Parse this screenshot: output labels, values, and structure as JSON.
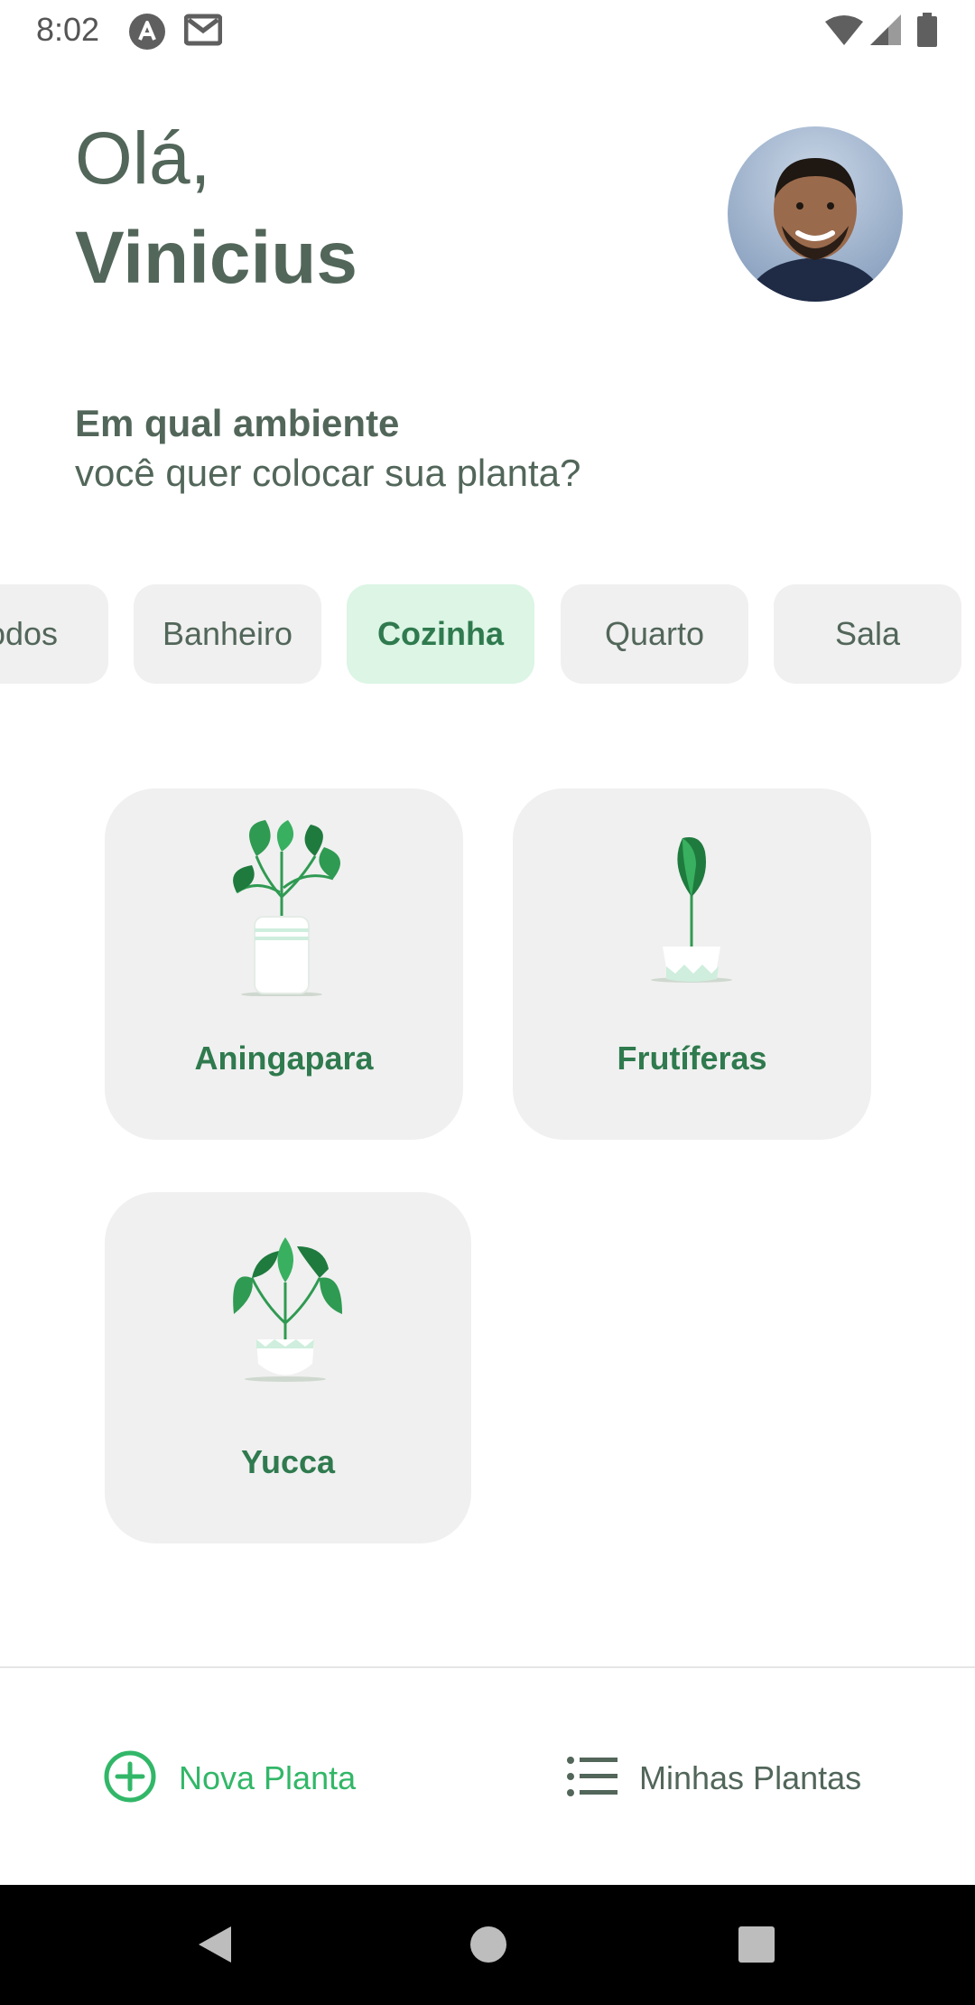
{
  "status_bar": {
    "time": "8:02",
    "icons_left": [
      "notification-a-icon",
      "gmail-icon"
    ],
    "icons_right": [
      "wifi-icon",
      "signal-icon",
      "battery-icon"
    ]
  },
  "header": {
    "greeting": "Olá,",
    "user_name": "Vinicius"
  },
  "question": {
    "title": "Em qual ambiente",
    "subtitle": "você quer colocar sua planta?"
  },
  "environments": [
    {
      "label": "Todos",
      "active": false
    },
    {
      "label": "Banheiro",
      "active": false
    },
    {
      "label": "Cozinha",
      "active": true
    },
    {
      "label": "Quarto",
      "active": false
    },
    {
      "label": "Sala",
      "active": false
    }
  ],
  "plants": [
    {
      "name": "Aningapara"
    },
    {
      "name": "Frutíferas"
    },
    {
      "name": "Yucca"
    }
  ],
  "bottom_nav": {
    "new_plant": "Nova Planta",
    "my_plants": "Minhas Plantas"
  },
  "colors": {
    "green": "#32b768",
    "green_dark": "#2f7a4e",
    "heading": "#52665a",
    "chip_active_bg": "#dcf5e5",
    "card_bg": "#f0f0f0"
  }
}
